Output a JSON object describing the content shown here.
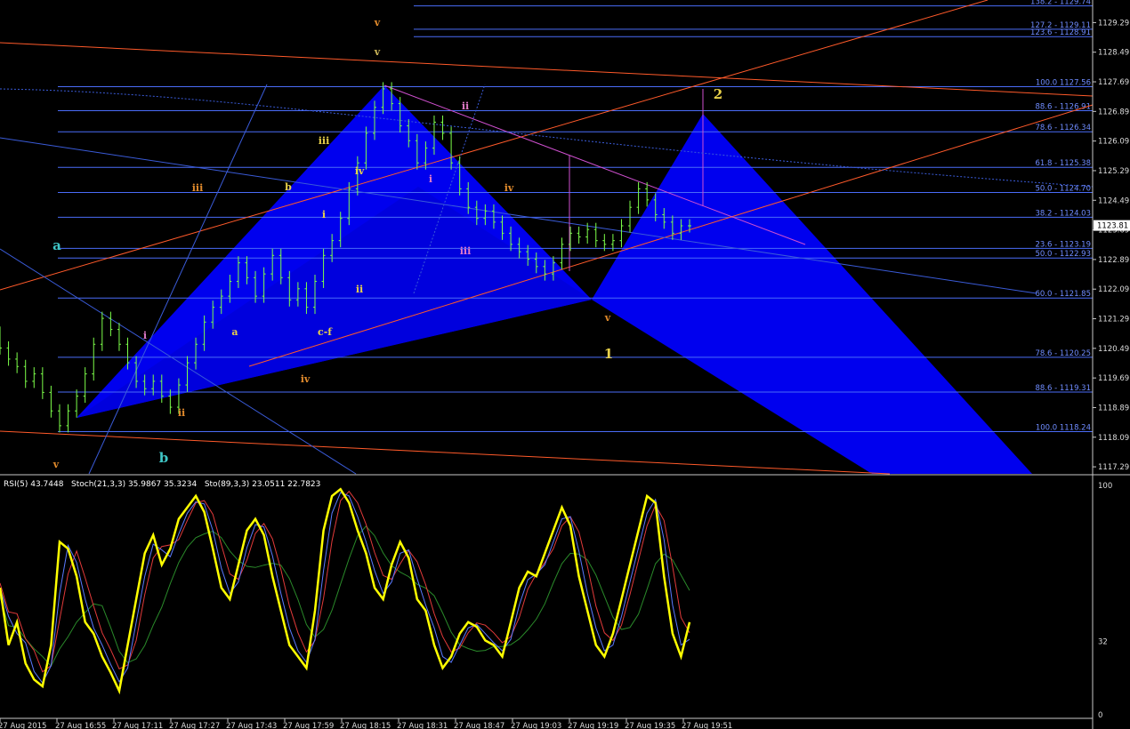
{
  "chart_data": {
    "type": "line",
    "price_axis": {
      "ticks": [
        "1129.29",
        "1128.49",
        "1127.69",
        "1126.89",
        "1126.09",
        "1125.29",
        "1124.49",
        "1123.69",
        "1122.89",
        "1122.09",
        "1121.29",
        "1120.49",
        "1119.69",
        "1118.89",
        "1118.09",
        "1117.29"
      ],
      "current_price": "1123.81",
      "ylim": [
        1117.1,
        1129.9
      ]
    },
    "fib_levels": [
      {
        "label": "138.2 - 1129.74",
        "value": 1129.74,
        "color": "#4a6cf7"
      },
      {
        "label": "127.2 - 1129.11",
        "value": 1129.11,
        "color": "#4a6cf7"
      },
      {
        "label": "123.6 - 1128.91",
        "value": 1128.91,
        "color": "#4a6cf7"
      },
      {
        "label": "100.0 1127.56",
        "value": 1127.56,
        "color": "#4a6cf7"
      },
      {
        "label": "88.6 - 1126.91",
        "value": 1126.91,
        "color": "#4a6cf7"
      },
      {
        "label": "78.6 - 1126.34",
        "value": 1126.34,
        "color": "#4a6cf7"
      },
      {
        "label": "61.8 - 1125.38",
        "value": 1125.38,
        "color": "#4a6cf7"
      },
      {
        "label": "50.0 - 1124.70",
        "value": 1124.7,
        "color": "#4a6cf7"
      },
      {
        "label": "38.2 - 1124.03",
        "value": 1124.03,
        "color": "#4a6cf7"
      },
      {
        "label": "23.6 - 1123.19",
        "value": 1123.19,
        "color": "#4a6cf7"
      },
      {
        "label": "50.0 - 1122.93",
        "value": 1122.93,
        "color": "#4a6cf7"
      },
      {
        "label": "60.0 - 1121.85",
        "value": 1121.85,
        "color": "#4a6cf7"
      },
      {
        "label": "78.6 - 1120.25",
        "value": 1120.25,
        "color": "#4a6cf7"
      },
      {
        "label": "88.6 - 1119.31",
        "value": 1119.31,
        "color": "#4a6cf7"
      },
      {
        "label": "100.0 1118.24",
        "value": 1118.24,
        "color": "#4a6cf7"
      }
    ],
    "wave_labels": [
      {
        "text": "v",
        "color": "#e08a2c"
      },
      {
        "text": "v",
        "color": "#c9b458"
      },
      {
        "text": "iii",
        "color": "#e08a2c"
      },
      {
        "text": "b",
        "color": "#e8d14a"
      },
      {
        "text": "iii",
        "color": "#e8d14a"
      },
      {
        "text": "iv",
        "color": "#e8d14a"
      },
      {
        "text": "i",
        "color": "#e8d14a"
      },
      {
        "text": "ii",
        "color": "#e8d14a"
      },
      {
        "text": "a",
        "color": "#e8d14a"
      },
      {
        "text": "c-f",
        "color": "#e8d14a"
      },
      {
        "text": "iv",
        "color": "#e08a2c"
      },
      {
        "text": "ii",
        "color": "#e07ac8"
      },
      {
        "text": "i",
        "color": "#e07ac8"
      },
      {
        "text": "iv",
        "color": "#e08a2c"
      },
      {
        "text": "iii",
        "color": "#e07ac8"
      },
      {
        "text": "i",
        "color": "#e07ac8"
      },
      {
        "text": "ii",
        "color": "#e08a2c"
      },
      {
        "text": "a",
        "color": "#3fc6c6"
      },
      {
        "text": "b",
        "color": "#3fc6c6"
      },
      {
        "text": "v",
        "color": "#e08a2c"
      },
      {
        "text": "v",
        "color": "#e08a2c"
      },
      {
        "text": "1",
        "color": "#e8d14a"
      },
      {
        "text": "2",
        "color": "#e8d14a"
      }
    ],
    "x_axis_labels": [
      "27 Aug 2015",
      "27 Aug 16:55",
      "27 Aug 17:11",
      "27 Aug 17:27",
      "27 Aug 17:43",
      "27 Aug 17:59",
      "27 Aug 18:15",
      "27 Aug 18:31",
      "27 Aug 18:47",
      "27 Aug 19:03",
      "27 Aug 19:19",
      "27 Aug 19:35",
      "27 Aug 19:51"
    ],
    "price_series": [
      1120.9,
      1120.5,
      1120.2,
      1120.0,
      1119.6,
      1119.8,
      1119.3,
      1118.8,
      1118.4,
      1118.8,
      1119.2,
      1119.8,
      1120.6,
      1121.3,
      1121.0,
      1120.6,
      1120.1,
      1119.6,
      1119.4,
      1119.6,
      1119.2,
      1118.9,
      1119.5,
      1120.1,
      1120.6,
      1121.2,
      1121.6,
      1121.9,
      1122.3,
      1122.8,
      1122.4,
      1121.9,
      1122.5,
      1123.0,
      1122.4,
      1121.8,
      1122.1,
      1121.6,
      1122.3,
      1123.0,
      1123.4,
      1124.0,
      1124.8,
      1125.5,
      1126.3,
      1127.0,
      1127.5,
      1127.1,
      1126.5,
      1126.1,
      1125.5,
      1125.9,
      1126.6,
      1126.3,
      1125.5,
      1124.8,
      1124.3,
      1124.0,
      1124.2,
      1123.9,
      1123.6,
      1123.3,
      1123.1,
      1122.9,
      1122.7,
      1122.5,
      1122.8,
      1123.3,
      1123.6,
      1123.5,
      1123.7,
      1123.4,
      1123.3,
      1123.4,
      1123.8,
      1124.3,
      1124.8,
      1124.5,
      1124.1,
      1123.9,
      1123.6,
      1123.8
    ],
    "oscillator": {
      "title": "RSI(5) 43.7448   Stoch(21,3,3) 35.9867 35.3234   Sto(89,3,3) 23.0511 22.7823",
      "ticks": [
        "100",
        "32",
        "0"
      ],
      "ylim": [
        0,
        100
      ],
      "series": [
        {
          "name": "RSI(5)",
          "color": "#ffff00"
        },
        {
          "name": "Stoch(21,3,3)",
          "color": "#5a7aff"
        },
        {
          "name": "Sto(89,3,3)",
          "color": "#e23a3a"
        }
      ],
      "rsi_values": [
        55,
        30,
        40,
        22,
        15,
        12,
        30,
        75,
        72,
        60,
        40,
        35,
        25,
        18,
        10,
        30,
        50,
        70,
        78,
        65,
        72,
        85,
        90,
        95,
        88,
        72,
        55,
        50,
        65,
        80,
        85,
        78,
        60,
        45,
        30,
        25,
        20,
        45,
        80,
        95,
        98,
        92,
        80,
        70,
        55,
        50,
        65,
        75,
        68,
        50,
        45,
        30,
        20,
        25,
        35,
        40,
        38,
        32,
        30,
        25,
        40,
        55,
        62,
        60,
        70,
        80,
        90,
        82,
        60,
        45,
        30,
        25,
        35,
        50,
        65,
        80,
        95,
        92,
        60,
        35,
        25,
        40
      ]
    }
  }
}
